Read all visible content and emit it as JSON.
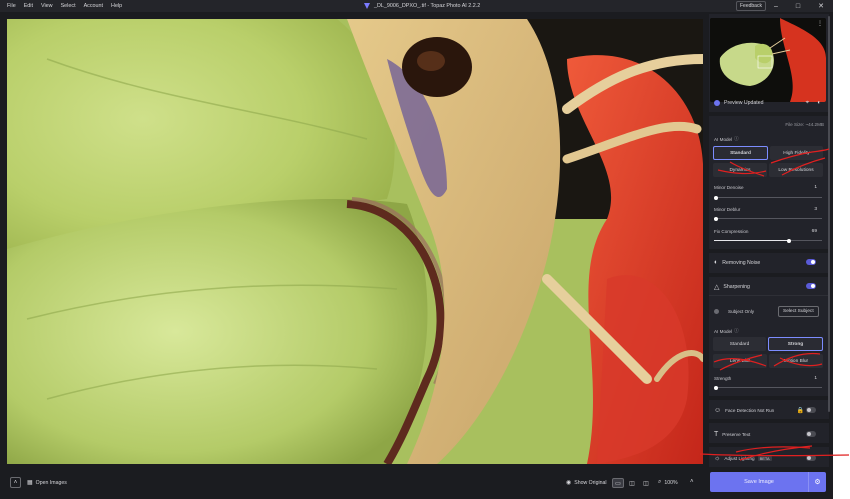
{
  "menu": [
    "File",
    "Edit",
    "View",
    "Select",
    "Account",
    "Help"
  ],
  "window": {
    "title": "_DL_9006_DPXO_.tif - Topaz Photo AI 2.2.2",
    "feedback": "Feedback"
  },
  "bottom": {
    "open_images": "Open Images",
    "show_original": "Show Original",
    "zoom": "100%"
  },
  "panel": {
    "preview_updated": "Preview Updated",
    "file_size": "File Size: ~44.2MB",
    "ai_model_1": "AI Model",
    "denoise_models": [
      "Standard",
      "High Fidelity",
      "Dynamics",
      "Low Resolutions"
    ],
    "minor_denoise": {
      "label": "Minor Denoise",
      "value": "1",
      "level": 0.0
    },
    "minor_deblur": {
      "label": "Minor Deblur",
      "value": "3",
      "level": 0.02
    },
    "fix_compression": {
      "label": "Fix Compression",
      "value": "69",
      "level": 0.69
    },
    "removing_noise": "Removing Noise",
    "sharpening": "Sharpening",
    "subject_only": "Subject Only",
    "select_subject": "Select Subject",
    "ai_model_2": "AI Model",
    "sharpen_models": [
      "Standard",
      "Strong",
      "Lens Blur",
      "Motion Blur"
    ],
    "strength": {
      "label": "Strength",
      "value": "1",
      "level": 0.0
    },
    "face_detection": "Face Detection Not Run",
    "preserve_text": "Preserve Text",
    "adjust_lighting": "Adjust Lighting",
    "beta": "BETA",
    "save": "Save Image"
  },
  "colors": {
    "accent": "#6c73f0",
    "panel": "#22232a",
    "background": "#1b1c20"
  }
}
